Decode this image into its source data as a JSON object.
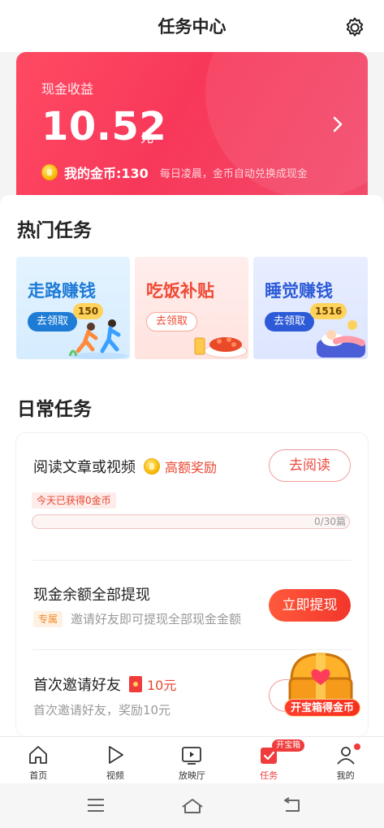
{
  "header": {
    "title": "任务中心"
  },
  "cash": {
    "label": "现金收益",
    "amount": "10.52",
    "unit": "元",
    "coins_label": "我的金币:130",
    "coins_note": "每日凌晨，金币自动兑换成现金"
  },
  "hot": {
    "title": "热门任务",
    "cards": [
      {
        "title": "走路赚钱",
        "button": "去领取",
        "badge": "150"
      },
      {
        "title": "吃饭补贴",
        "button": "去领取"
      },
      {
        "title": "睡觉赚钱",
        "button": "去领取",
        "badge": "1516"
      }
    ]
  },
  "daily": {
    "title": "日常任务",
    "tasks": [
      {
        "title": "阅读文章或视频",
        "reward": "高额奖励",
        "tag": "今天已获得0金币",
        "progress_text": "0/30篇",
        "progress": 0,
        "button": "去阅读"
      },
      {
        "title": "现金余额全部提现",
        "tag": "专属",
        "subtitle": "邀请好友即可提现全部现金金额",
        "button": "立即提现"
      },
      {
        "title": "首次邀请好友",
        "reward": "10元",
        "subtitle": "首次邀请好友，奖励10元"
      }
    ],
    "treasure_label": "开宝箱得金币"
  },
  "tabbar": {
    "tabs": [
      {
        "label": "首页"
      },
      {
        "label": "视频"
      },
      {
        "label": "放映厅"
      },
      {
        "label": "任务",
        "badge": "开宝箱"
      },
      {
        "label": "我的"
      }
    ]
  },
  "colors": {
    "accent": "#ef3b3b",
    "card_red": "#f8385a",
    "blue": "#1e7bd6"
  }
}
